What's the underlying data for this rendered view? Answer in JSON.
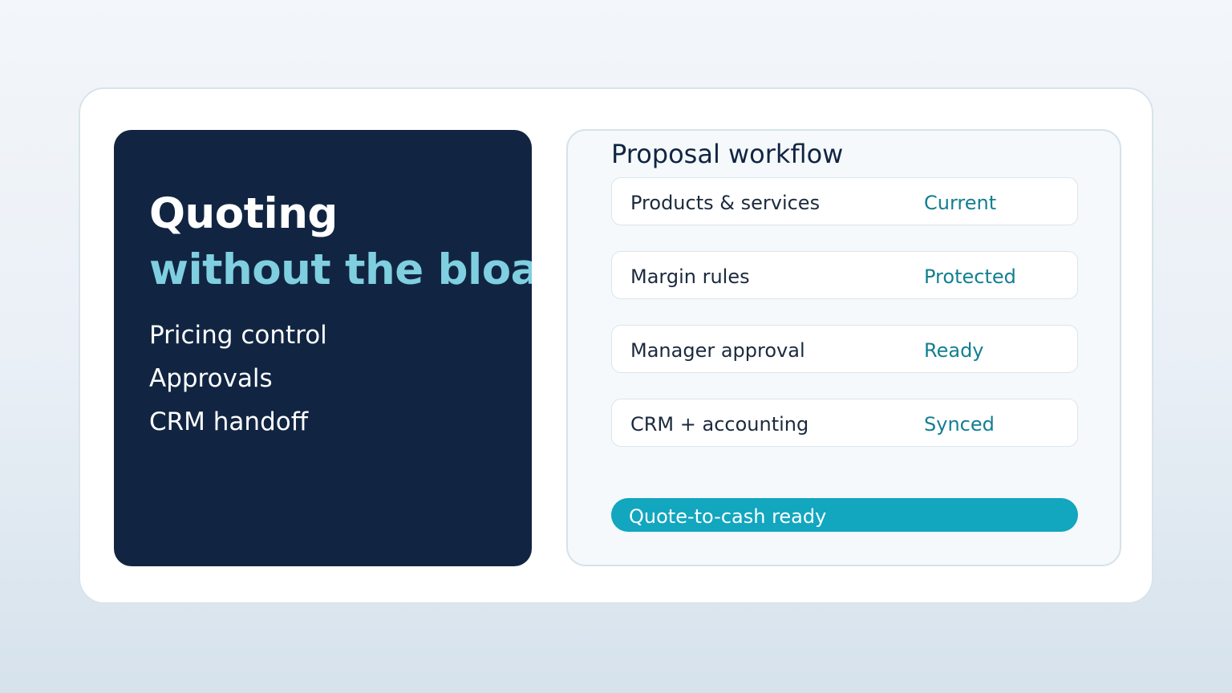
{
  "hero": {
    "title_line1": "Quoting",
    "title_line2": "without the bloat",
    "features": [
      "Pricing control",
      "Approvals",
      "CRM handoff"
    ]
  },
  "workflow": {
    "title": "Proposal workflow",
    "steps": [
      {
        "label": "Products & services",
        "status": "Current"
      },
      {
        "label": "Margin rules",
        "status": "Protected"
      },
      {
        "label": "Manager approval",
        "status": "Ready"
      },
      {
        "label": "CRM + accounting",
        "status": "Synced"
      }
    ],
    "status_bar_label": "Quote-to-cash ready"
  },
  "colors": {
    "hero_background": "#112542",
    "accent_text": "#7fcfe0",
    "status_text": "#127f91",
    "status_bar": "#12a6bf"
  }
}
